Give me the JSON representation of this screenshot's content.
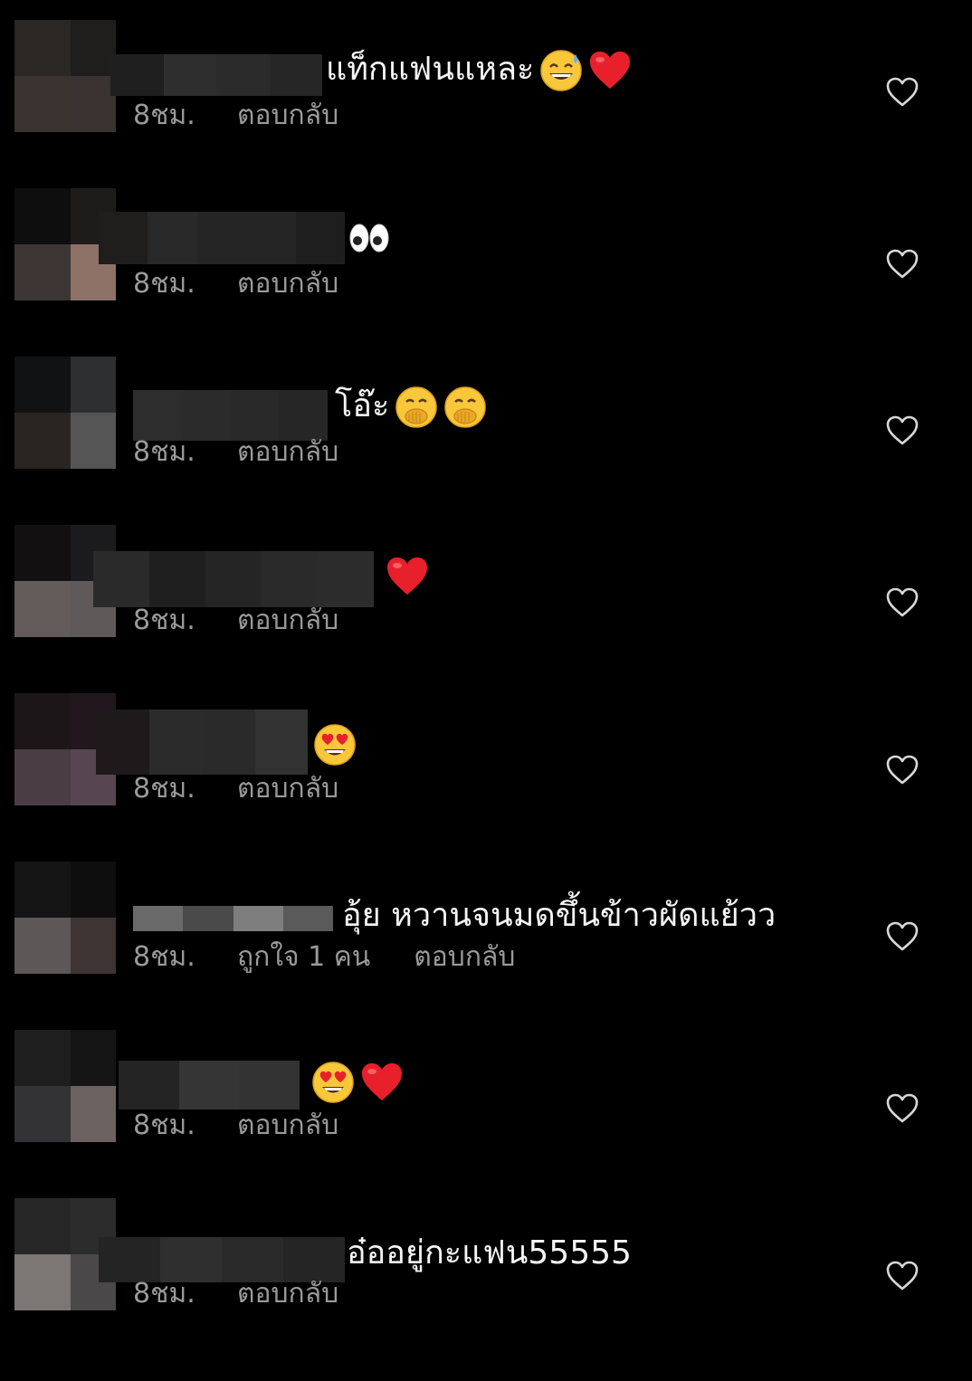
{
  "comments": [
    {
      "text": "แท็กแฟนแหละ",
      "emojis": [
        "sweat-smile",
        "red-heart"
      ],
      "time": "8ชม.",
      "likes": "",
      "reply": "ตอบกลับ"
    },
    {
      "text": "",
      "emojis": [
        "eyes"
      ],
      "time": "8ชม.",
      "likes": "",
      "reply": "ตอบกลับ"
    },
    {
      "text": "โอ๊ะ",
      "emojis": [
        "face-hand-over-mouth",
        "face-hand-over-mouth"
      ],
      "time": "8ชม.",
      "likes": "",
      "reply": "ตอบกลับ"
    },
    {
      "text": "",
      "emojis": [
        "red-heart"
      ],
      "time": "8ชม.",
      "likes": "",
      "reply": "ตอบกลับ"
    },
    {
      "text": "",
      "emojis": [
        "heart-eyes"
      ],
      "time": "8ชม.",
      "likes": "",
      "reply": "ตอบกลับ"
    },
    {
      "text": "อุ้ย หวานจนมดขึ้นข้าวผัดแย้วว",
      "emojis": [],
      "time": "8ชม.",
      "likes": "ถูกใจ 1 คน",
      "reply": "ตอบกลับ"
    },
    {
      "text": "",
      "emojis": [
        "heart-eyes",
        "red-heart"
      ],
      "time": "8ชม.",
      "likes": "",
      "reply": "ตอบกลับ"
    },
    {
      "text": "อ๋ออยู่กะแฟน55555",
      "emojis": [],
      "time": "8ชม.",
      "likes": "",
      "reply": "ตอบกลับ"
    }
  ],
  "icons": {
    "like": "heart-outline-icon"
  },
  "colors": {
    "background": "#000000",
    "text": "#f5f5f5",
    "meta_text": "#9a9a9a",
    "heart_red": "#e8202c"
  }
}
